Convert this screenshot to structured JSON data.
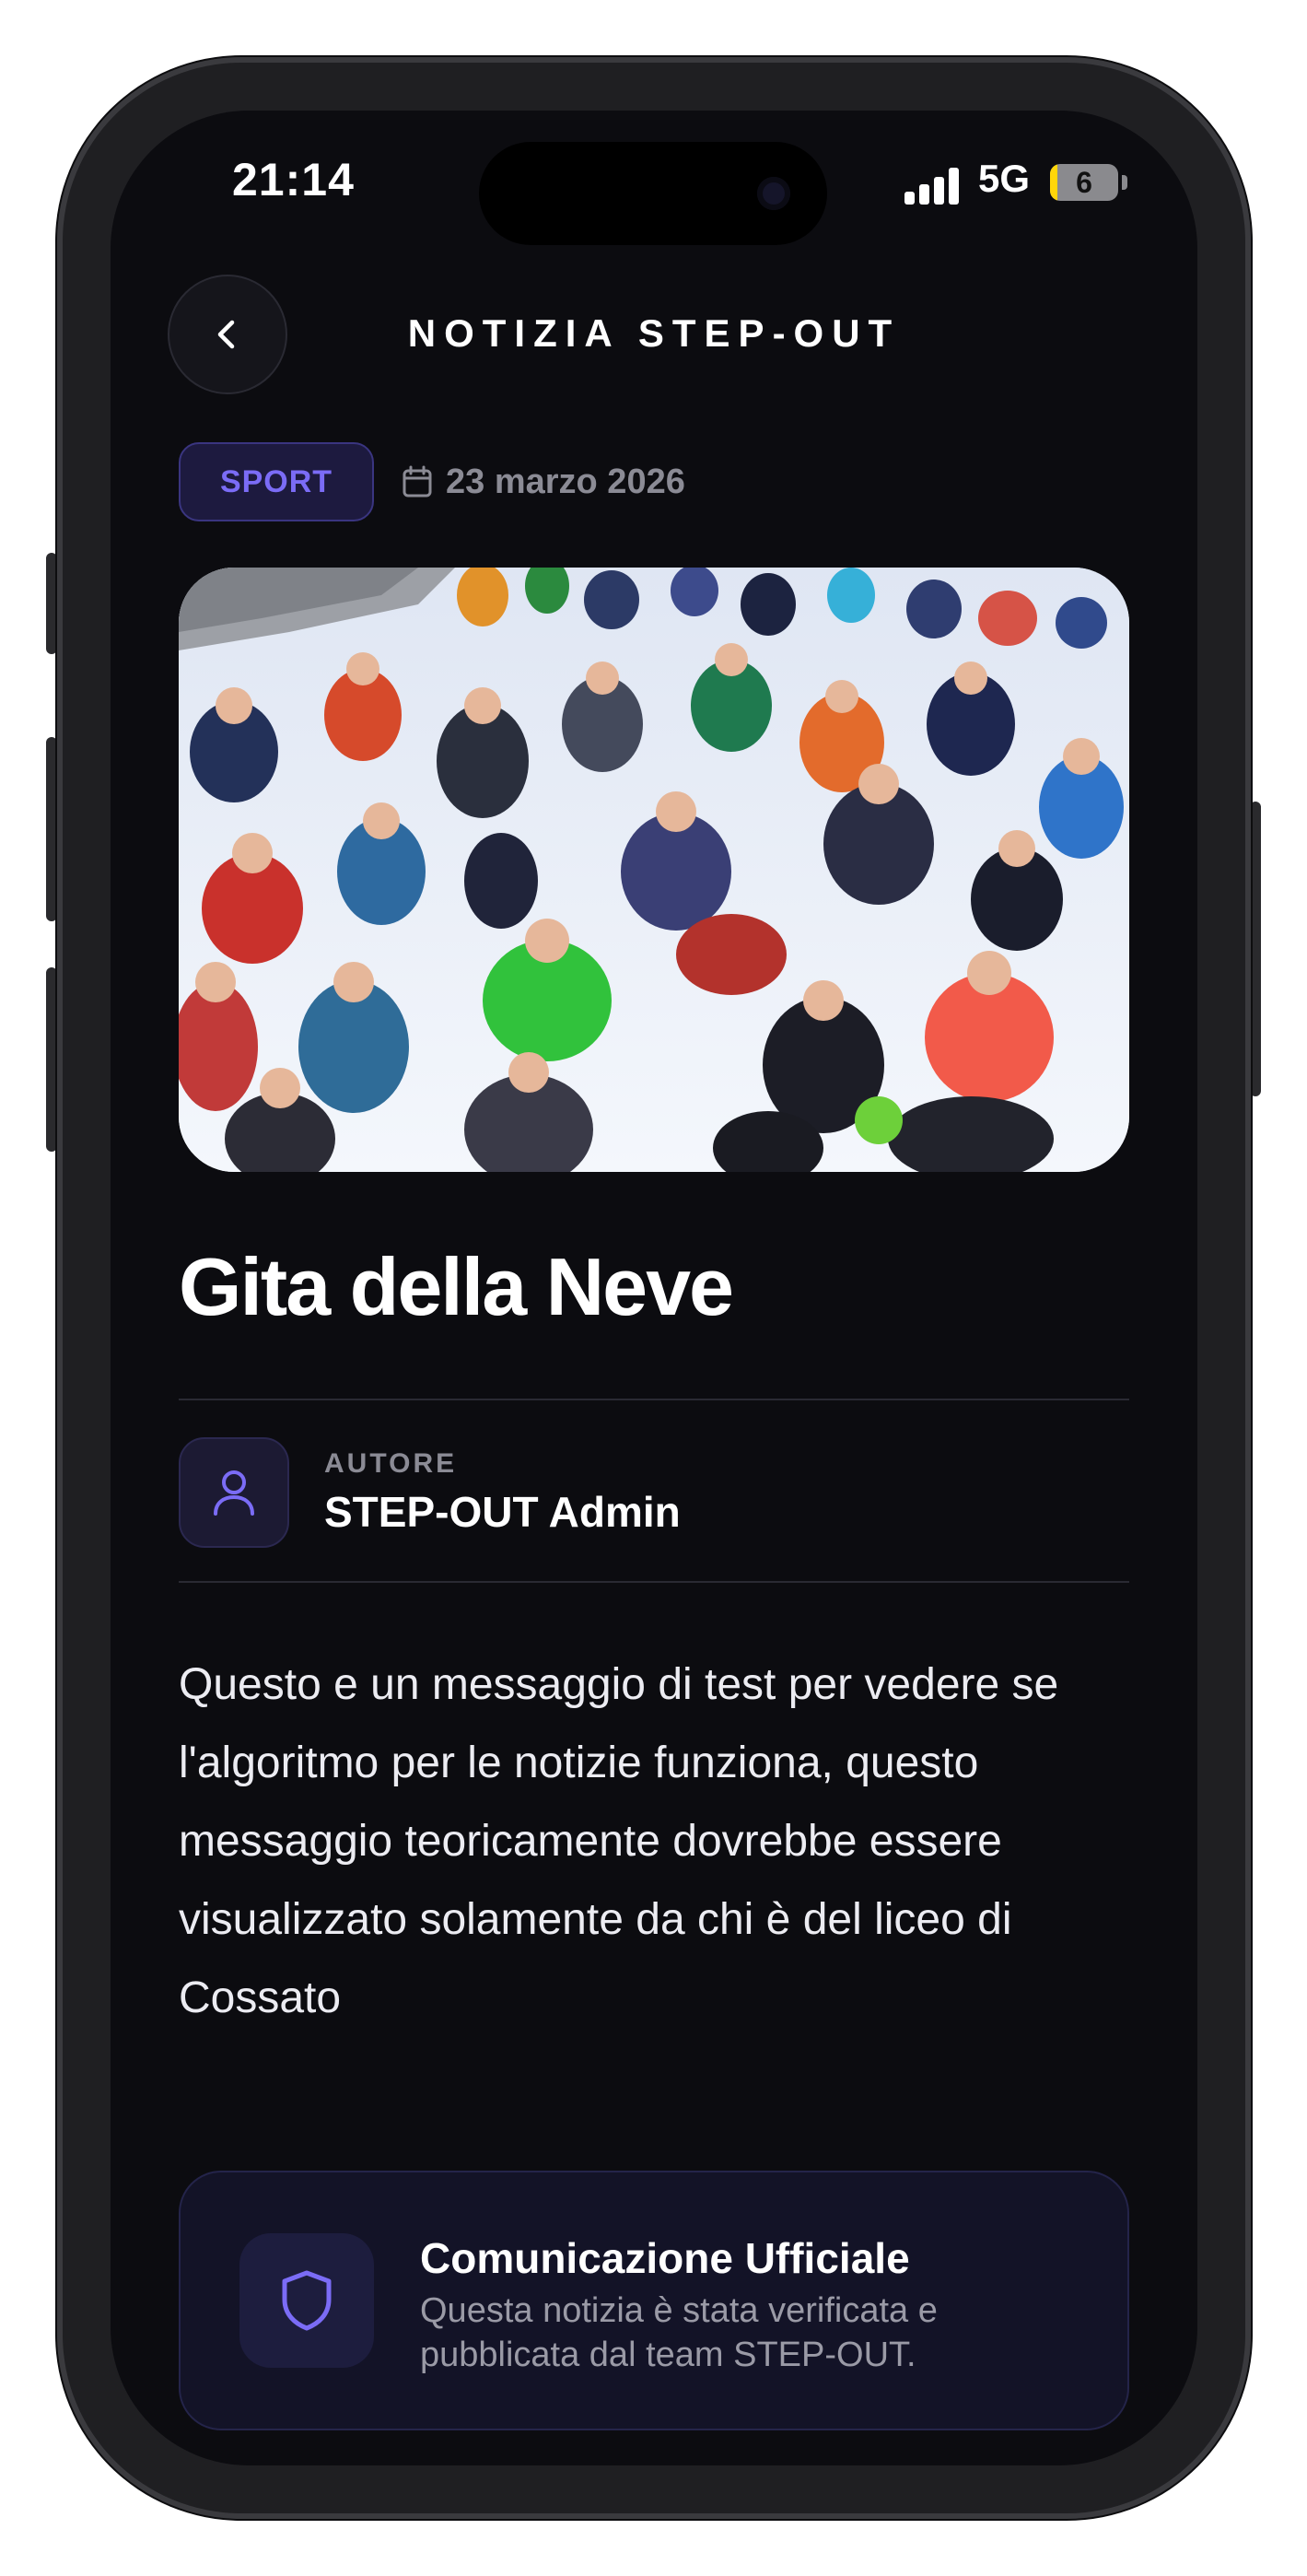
{
  "status_bar": {
    "time": "21:14",
    "network": "5G",
    "battery": "6",
    "battery_fraction": 0.06
  },
  "header": {
    "title": "NOTIZIA STEP-OUT",
    "back_icon": "chevron-left-icon"
  },
  "article": {
    "category": "SPORT",
    "category_color": "#7b6cf6",
    "date_icon": "calendar-icon",
    "date": "23 marzo 2026",
    "image_alt": "Gruppo di studenti seduti sulla neve",
    "title": "Gita della Neve",
    "author_label": "AUTORE",
    "author_name": "STEP-OUT Admin",
    "author_icon": "user-icon",
    "body": "Questo e un messaggio di test per vedere se l'algoritmo per le notizie funziona, questo messaggio teoricamente dovrebbe essere visualizzato solamente da chi è del liceo di Cossato"
  },
  "official_card": {
    "icon": "shield-icon",
    "title": "Comunicazione Ufficiale",
    "description": "Questa notizia è stata verificata e pubblicata dal team STEP-OUT."
  },
  "colors": {
    "background": "#0c0c10",
    "accent": "#7b6cf6",
    "muted_text": "#8b8b95"
  }
}
